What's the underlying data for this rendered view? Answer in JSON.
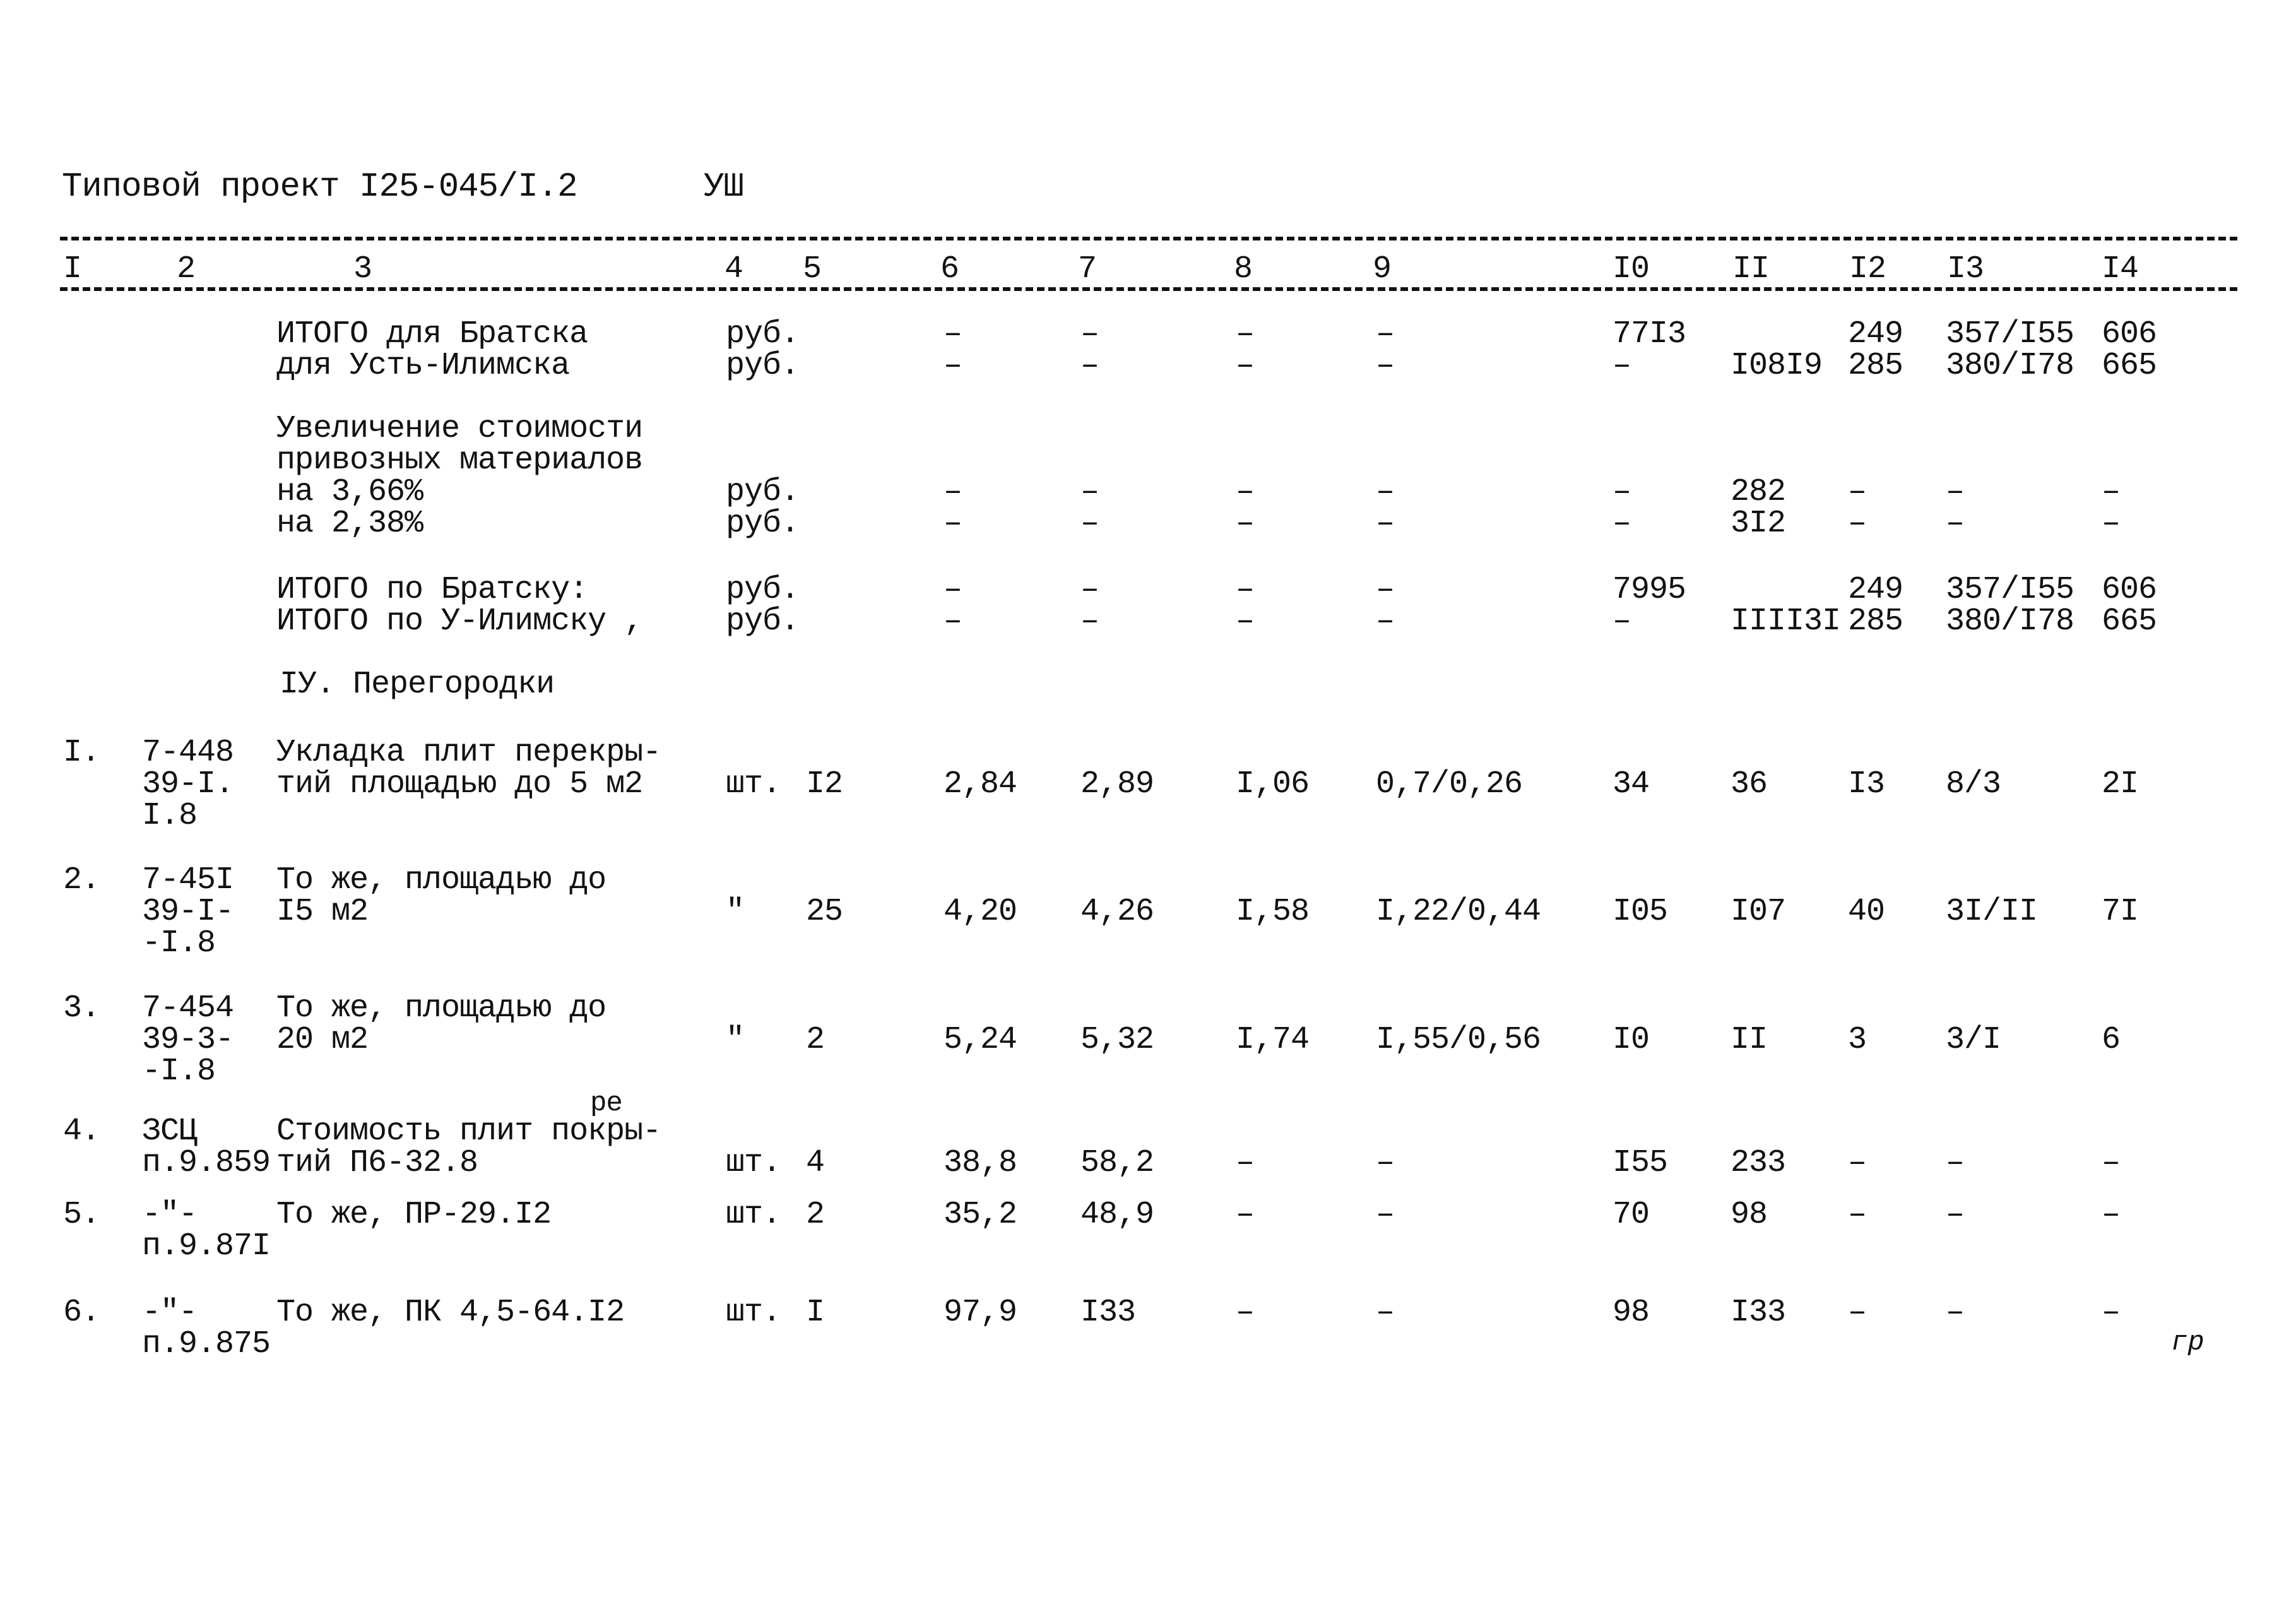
{
  "header": {
    "title": "Типовой проект I25-045/I.2",
    "section_mark": "УШ"
  },
  "columns": [
    "I",
    "2",
    "3",
    "4",
    "5",
    "6",
    "7",
    "8",
    "9",
    "I0",
    "II",
    "I2",
    "I3",
    "I4"
  ],
  "totals_block_1": {
    "rows": [
      {
        "c3": "ИТОГО для Братска",
        "c4": "руб.",
        "c6": "–",
        "c7": "–",
        "c8": "–",
        "c9": "–",
        "c10": "77I3",
        "c11": "",
        "c12": "249",
        "c13": "357/I55",
        "c14": "606"
      },
      {
        "c3": "для Усть-Илимска",
        "c4": "руб.",
        "c6": "–",
        "c7": "–",
        "c8": "–",
        "c9": "–",
        "c10": "–",
        "c11": "I08I9",
        "c12": "285",
        "c13": "380/I78",
        "c14": "665"
      }
    ]
  },
  "increase_block": {
    "label_line1": "Увеличение стоимости",
    "label_line2": "привозных материалов",
    "rows": [
      {
        "c3": "на 3,66%",
        "c4": "руб.",
        "c6": "–",
        "c7": "–",
        "c8": "–",
        "c9": "–",
        "c10": "–",
        "c11": "282",
        "c12": "–",
        "c13": "–",
        "c14": "–"
      },
      {
        "c3": "на 2,38%",
        "c4": "руб.",
        "c6": "–",
        "c7": "–",
        "c8": "–",
        "c9": "–",
        "c10": "–",
        "c11": "3I2",
        "c12": "–",
        "c13": "–",
        "c14": "–"
      }
    ]
  },
  "totals_block_2": {
    "rows": [
      {
        "c3": "ИТОГО по Братску:",
        "c4": "руб.",
        "c6": "–",
        "c7": "–",
        "c8": "–",
        "c9": "–",
        "c10": "7995",
        "c11": "",
        "c12": "249",
        "c13": "357/I55",
        "c14": "606"
      },
      {
        "c3": "ИТОГО по У-Илимску ,",
        "c4": "руб.",
        "c6": "–",
        "c7": "–",
        "c8": "–",
        "c9": "–",
        "c10": "–",
        "c11": "IIII3I",
        "c12": "285",
        "c13": "380/I78",
        "c14": "665"
      }
    ]
  },
  "section_heading": "IУ. Перегородки",
  "items": [
    {
      "num": "I.",
      "code": [
        "7-448",
        "39-I.",
        "I.8"
      ],
      "desc": [
        "Укладка плит перекры-",
        "тий площадью до 5 м2"
      ],
      "unit": "шт.",
      "qty": "I2",
      "c6": "2,84",
      "c7": "2,89",
      "c8": "I,06",
      "c9": "0,7/0,26",
      "c10": "34",
      "c11": "36",
      "c12": "I3",
      "c13": "8/3",
      "c14": "2I"
    },
    {
      "num": "2.",
      "code": [
        "7-45I",
        "39-I-",
        "-I.8"
      ],
      "desc": [
        "То же, площадью до",
        "I5 м2"
      ],
      "unit": "\"",
      "qty": "25",
      "c6": "4,20",
      "c7": "4,26",
      "c8": "I,58",
      "c9": "I,22/0,44",
      "c10": "I05",
      "c11": "I07",
      "c12": "40",
      "c13": "3I/II",
      "c14": "7I"
    },
    {
      "num": "3.",
      "code": [
        "7-454",
        "39-3-",
        "-I.8"
      ],
      "desc": [
        "То же, площадью до",
        "20 м2"
      ],
      "unit": "\"",
      "qty": "2",
      "c6": "5,24",
      "c7": "5,32",
      "c8": "I,74",
      "c9": "I,55/0,56",
      "c10": "I0",
      "c11": "II",
      "c12": "3",
      "c13": "3/I",
      "c14": "6"
    },
    {
      "num": "4.",
      "code": [
        "ЗСЦ",
        "п.9.859"
      ],
      "desc": [
        "Стоимость плит покры-",
        "тий П6-32.8"
      ],
      "desc_correction": "ре",
      "unit": "шт.",
      "qty": "4",
      "c6": "38,8",
      "c7": "58,2",
      "c8": "–",
      "c9": "–",
      "c10": "I55",
      "c11": "233",
      "c12": "–",
      "c13": "–",
      "c14": "–"
    },
    {
      "num": "5.",
      "code": [
        "-\"-",
        "п.9.87I"
      ],
      "desc": [
        "То же, ПР-29.I2"
      ],
      "unit": "шт.",
      "qty": "2",
      "c6": "35,2",
      "c7": "48,9",
      "c8": "–",
      "c9": "–",
      "c10": "70",
      "c11": "98",
      "c12": "–",
      "c13": "–",
      "c14": "–"
    },
    {
      "num": "6.",
      "code": [
        "-\"-",
        "п.9.875"
      ],
      "desc": [
        "То же, ПК 4,5-64.I2"
      ],
      "unit": "шт.",
      "qty": "I",
      "c6": "97,9",
      "c7": "I33",
      "c8": "–",
      "c9": "–",
      "c10": "98",
      "c11": "I33",
      "c12": "–",
      "c13": "–",
      "c14": "–"
    }
  ],
  "margin_note": "гр"
}
